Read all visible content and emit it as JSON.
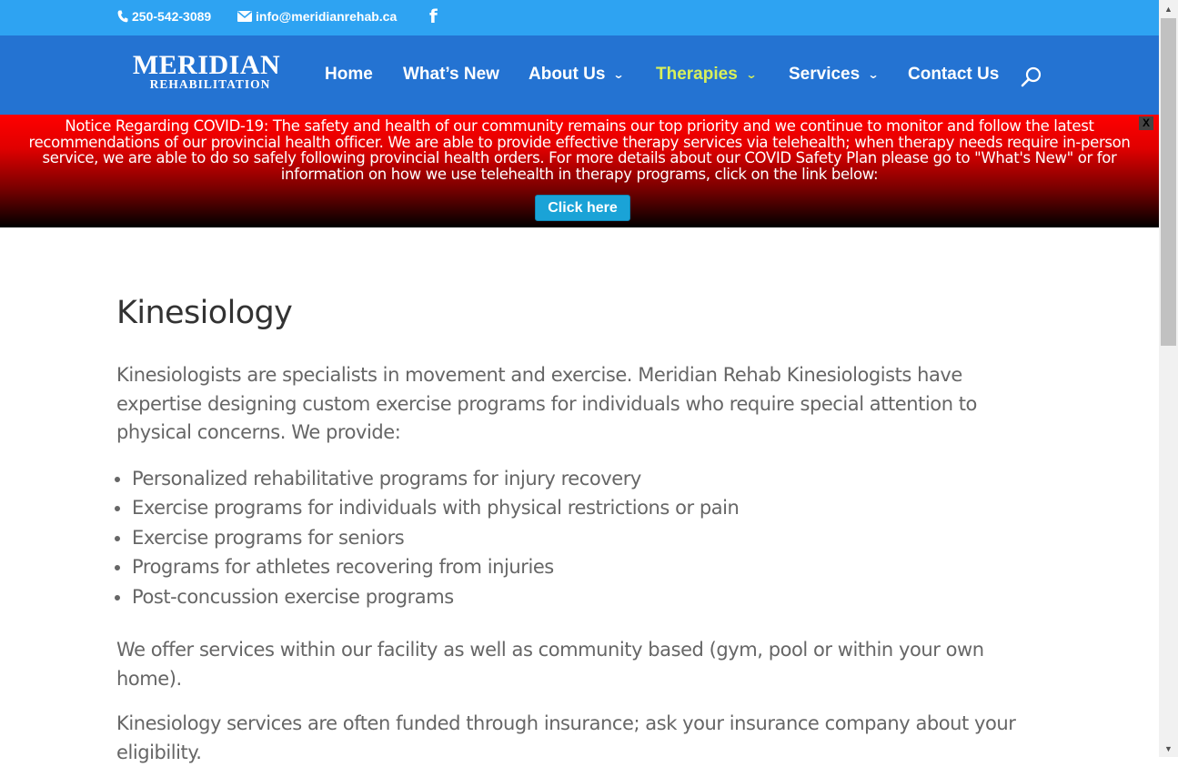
{
  "topbar": {
    "phone": "250-542-3089",
    "email": "info@meridianrehab.ca",
    "social_icon": "facebook-icon"
  },
  "header": {
    "logo_line1": "MERIDIAN",
    "logo_line2": "REHABILITATION",
    "nav": [
      {
        "label": "Home"
      },
      {
        "label": "What’s New"
      },
      {
        "label": "About Us"
      },
      {
        "label": "Therapies"
      },
      {
        "label": "Services"
      },
      {
        "label": "Contact Us"
      }
    ],
    "search_icon": "search-icon"
  },
  "notice": {
    "text": "Notice Regarding COVID-19: The safety and health of our community remains our top priority and we continue to monitor and follow the latest recommendations of our provincial health officer. We are able to provide effective therapy services via telehealth; when therapy needs require in-person service, we are able to do so safely following provincial health orders. For more details about our COVID Safety Plan please go to \"What's New\" or for information on how we use telehealth in therapy programs, click on the link below:",
    "button": "Click here",
    "close": "X"
  },
  "content": {
    "title": "Kinesiology",
    "intro": "Kinesiologists are specialists in movement and exercise. Meridian Rehab Kinesiologists have expertise designing custom exercise programs for individuals who require special attention to physical concerns. We provide:",
    "list": [
      "Personalized rehabilitative programs for injury recovery",
      "Exercise programs for individuals with physical restrictions or pain",
      "Exercise programs for seniors",
      "Programs for athletes recovering from injuries",
      "Post-concussion exercise programs"
    ],
    "para2": "We offer services within our facility as well as community based (gym, pool or within your own home).",
    "para3": "Kinesiology services are often funded through insurance; ask your insurance company about your eligibility."
  },
  "colors": {
    "topbar": "#2ea3f2",
    "header": "#2473d2",
    "active_nav": "#d8f05a",
    "notice_top": "#ff0000",
    "notice_bottom": "#000000",
    "notice_button": "#1aa3d7"
  }
}
